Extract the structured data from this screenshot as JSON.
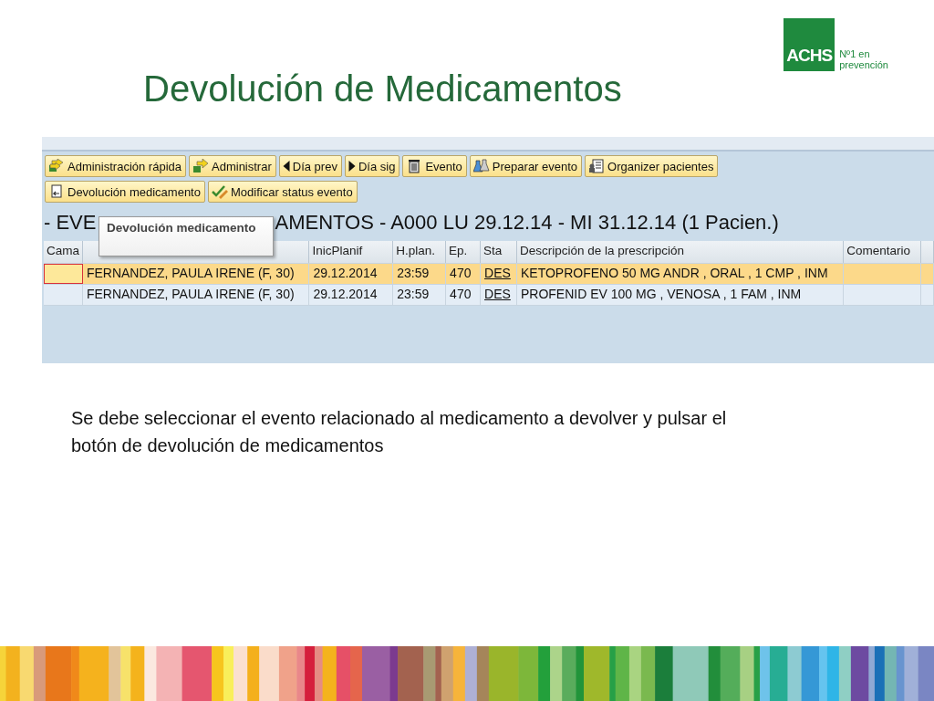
{
  "slide": {
    "title": "Devolución de Medicamentos",
    "logo": {
      "mark": "ACHS",
      "tagline_1": "Nº1 en",
      "tagline_2": "prevención"
    },
    "caption": "Se debe seleccionar el evento relacionado al medicamento a devolver y pulsar el botón de devolución de medicamentos"
  },
  "screen": {
    "toolbar_rows": [
      [
        {
          "label": "Administración rápida",
          "kind": "arrows"
        },
        {
          "label": "Administrar",
          "kind": "arrow"
        },
        {
          "label": "Día prev",
          "kind": "left"
        },
        {
          "label": "Día sig",
          "kind": "right"
        },
        {
          "label": "Evento",
          "kind": "trash"
        },
        {
          "label": "Preparar evento",
          "kind": "flasks"
        },
        {
          "label": "Organizer pacientes",
          "kind": "organizer"
        }
      ],
      [
        {
          "label": "Devolución medicamento",
          "kind": "return"
        },
        {
          "label": "Modificar status evento",
          "kind": "check"
        }
      ]
    ],
    "heading_start": "- EVE",
    "heading_end": "AMENTOS - A000 LU 29.12.14 - MI 31.12.14 (1 Pacien.)",
    "tooltip": "Devolución medicamento",
    "table": {
      "columns": [
        "Cama",
        "",
        "InicPlanif",
        "H.plan.",
        "Ep.",
        "Sta",
        "Descripción de la prescripción",
        "Comentario",
        ""
      ],
      "rows": [
        {
          "selected": true,
          "cells": [
            "",
            "FERNANDEZ, PAULA IRENE (F, 30)",
            "29.12.2014",
            "23:59",
            "470",
            "DES",
            "KETOPROFENO 50 MG ANDR , ORAL , 1 CMP , INM",
            ""
          ]
        },
        {
          "selected": false,
          "cells": [
            "",
            "FERNANDEZ, PAULA IRENE (F, 30)",
            "29.12.2014",
            "23:59",
            "470",
            "DES",
            "PROFENID EV 100 MG , VENOSA , 1 FAM , INM",
            ""
          ]
        }
      ]
    }
  }
}
